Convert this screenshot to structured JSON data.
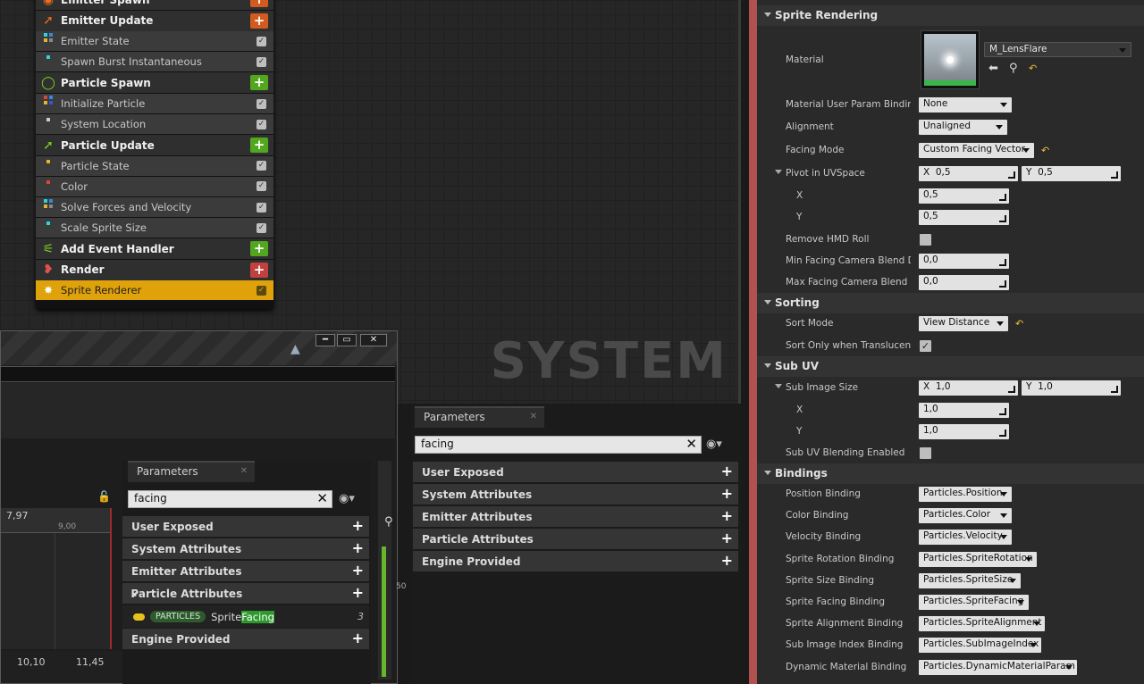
{
  "graph": {
    "watermark": "SYSTEM"
  },
  "stack": {
    "rows": [
      {
        "type": "hdr",
        "label": "Emitter Spawn",
        "icon": "emitter-spawn-icon",
        "plus": "orange",
        "color": "#f26b1d"
      },
      {
        "type": "hdr",
        "label": "Emitter Update",
        "icon": "emitter-update-icon",
        "plus": "orange",
        "color": "#f26b1d"
      },
      {
        "type": "mod",
        "label": "Emitter State",
        "icon": "module-dots-icon"
      },
      {
        "type": "mod",
        "label": "Spawn Burst Instantaneous",
        "icon": "module-dot-icon"
      },
      {
        "type": "hdr",
        "label": "Particle Spawn",
        "icon": "particle-spawn-icon",
        "plus": "green",
        "color": "#7ed321"
      },
      {
        "type": "mod",
        "label": "Initialize Particle",
        "icon": "module-dots-icon"
      },
      {
        "type": "mod",
        "label": "System Location",
        "icon": "module-dot-icon"
      },
      {
        "type": "hdr",
        "label": "Particle Update",
        "icon": "particle-update-icon",
        "plus": "green",
        "color": "#7ed321"
      },
      {
        "type": "mod",
        "label": "Particle State",
        "icon": "module-dot-icon"
      },
      {
        "type": "mod",
        "label": "Color",
        "icon": "module-dot-icon"
      },
      {
        "type": "mod",
        "label": "Solve Forces and Velocity",
        "icon": "module-dots-icon"
      },
      {
        "type": "mod",
        "label": "Scale Sprite Size",
        "icon": "module-dot-icon"
      },
      {
        "type": "hdr",
        "label": "Add Event Handler",
        "icon": "event-handler-icon",
        "plus": "green",
        "color": "#7ed321"
      },
      {
        "type": "hdr",
        "label": "Render",
        "icon": "render-icon",
        "plus": "red",
        "color": "#e0524b"
      },
      {
        "type": "sel",
        "label": "Sprite Renderer",
        "icon": "sprite-renderer-icon"
      }
    ]
  },
  "curve": {
    "ticks": [
      "7,97",
      "9,00",
      "10,10",
      "11,45"
    ],
    "side_tick": "50"
  },
  "panelA": {
    "tab": "Parameters",
    "search": "facing",
    "groups": [
      "User Exposed",
      "System Attributes",
      "Emitter Attributes",
      "Particle Attributes",
      "Engine Provided"
    ],
    "param": {
      "badge": "PARTICLES",
      "name_pre": "Sprite",
      "name_hl": "Facing",
      "count": "3"
    }
  },
  "panelB": {
    "tab": "Parameters",
    "search": "facing",
    "groups": [
      "User Exposed",
      "System Attributes",
      "Emitter Attributes",
      "Particle Attributes",
      "Engine Provided"
    ]
  },
  "details": {
    "sec_sprite": "Sprite Rendering",
    "sec_sorting": "Sorting",
    "sec_subuv": "Sub UV",
    "sec_bindings": "Bindings",
    "material_label": "Material",
    "material_value": "M_LensFlare",
    "mupb_label": "Material User Param Binding",
    "mupb_value": "None",
    "alignment_label": "Alignment",
    "alignment_value": "Unaligned",
    "facing_label": "Facing Mode",
    "facing_value": "Custom Facing Vector",
    "pivot_label": "Pivot in UVSpace",
    "pivot_x": "0,5",
    "pivot_y": "0,5",
    "x_label": "X",
    "y_label": "Y",
    "x_val": "0,5",
    "y_val": "0,5",
    "hmd_label": "Remove HMD Roll",
    "minf_label": "Min Facing Camera Blend Dis",
    "minf_val": "0,0",
    "maxf_label": "Max Facing Camera Blend Di",
    "maxf_val": "0,0",
    "sortmode_label": "Sort Mode",
    "sortmode_value": "View Distance",
    "sorttrans_label": "Sort Only when Translucent",
    "subsize_label": "Sub Image Size",
    "sub_x": "1,0",
    "sub_y": "1,0",
    "subx_val": "1,0",
    "suby_val": "1,0",
    "subblend_label": "Sub UV Blending Enabled",
    "bindings": [
      {
        "label": "Position Binding",
        "value": "Particles.Position"
      },
      {
        "label": "Color Binding",
        "value": "Particles.Color"
      },
      {
        "label": "Velocity Binding",
        "value": "Particles.Velocity"
      },
      {
        "label": "Sprite Rotation Binding",
        "value": "Particles.SpriteRotation"
      },
      {
        "label": "Sprite Size Binding",
        "value": "Particles.SpriteSize"
      },
      {
        "label": "Sprite Facing Binding",
        "value": "Particles.SpriteFacing"
      },
      {
        "label": "Sprite Alignment Binding",
        "value": "Particles.SpriteAlignment"
      },
      {
        "label": "Sub Image Index Binding",
        "value": "Particles.SubImageIndex"
      },
      {
        "label": "Dynamic Material Binding",
        "value": "Particles.DynamicMaterialParam"
      }
    ]
  }
}
